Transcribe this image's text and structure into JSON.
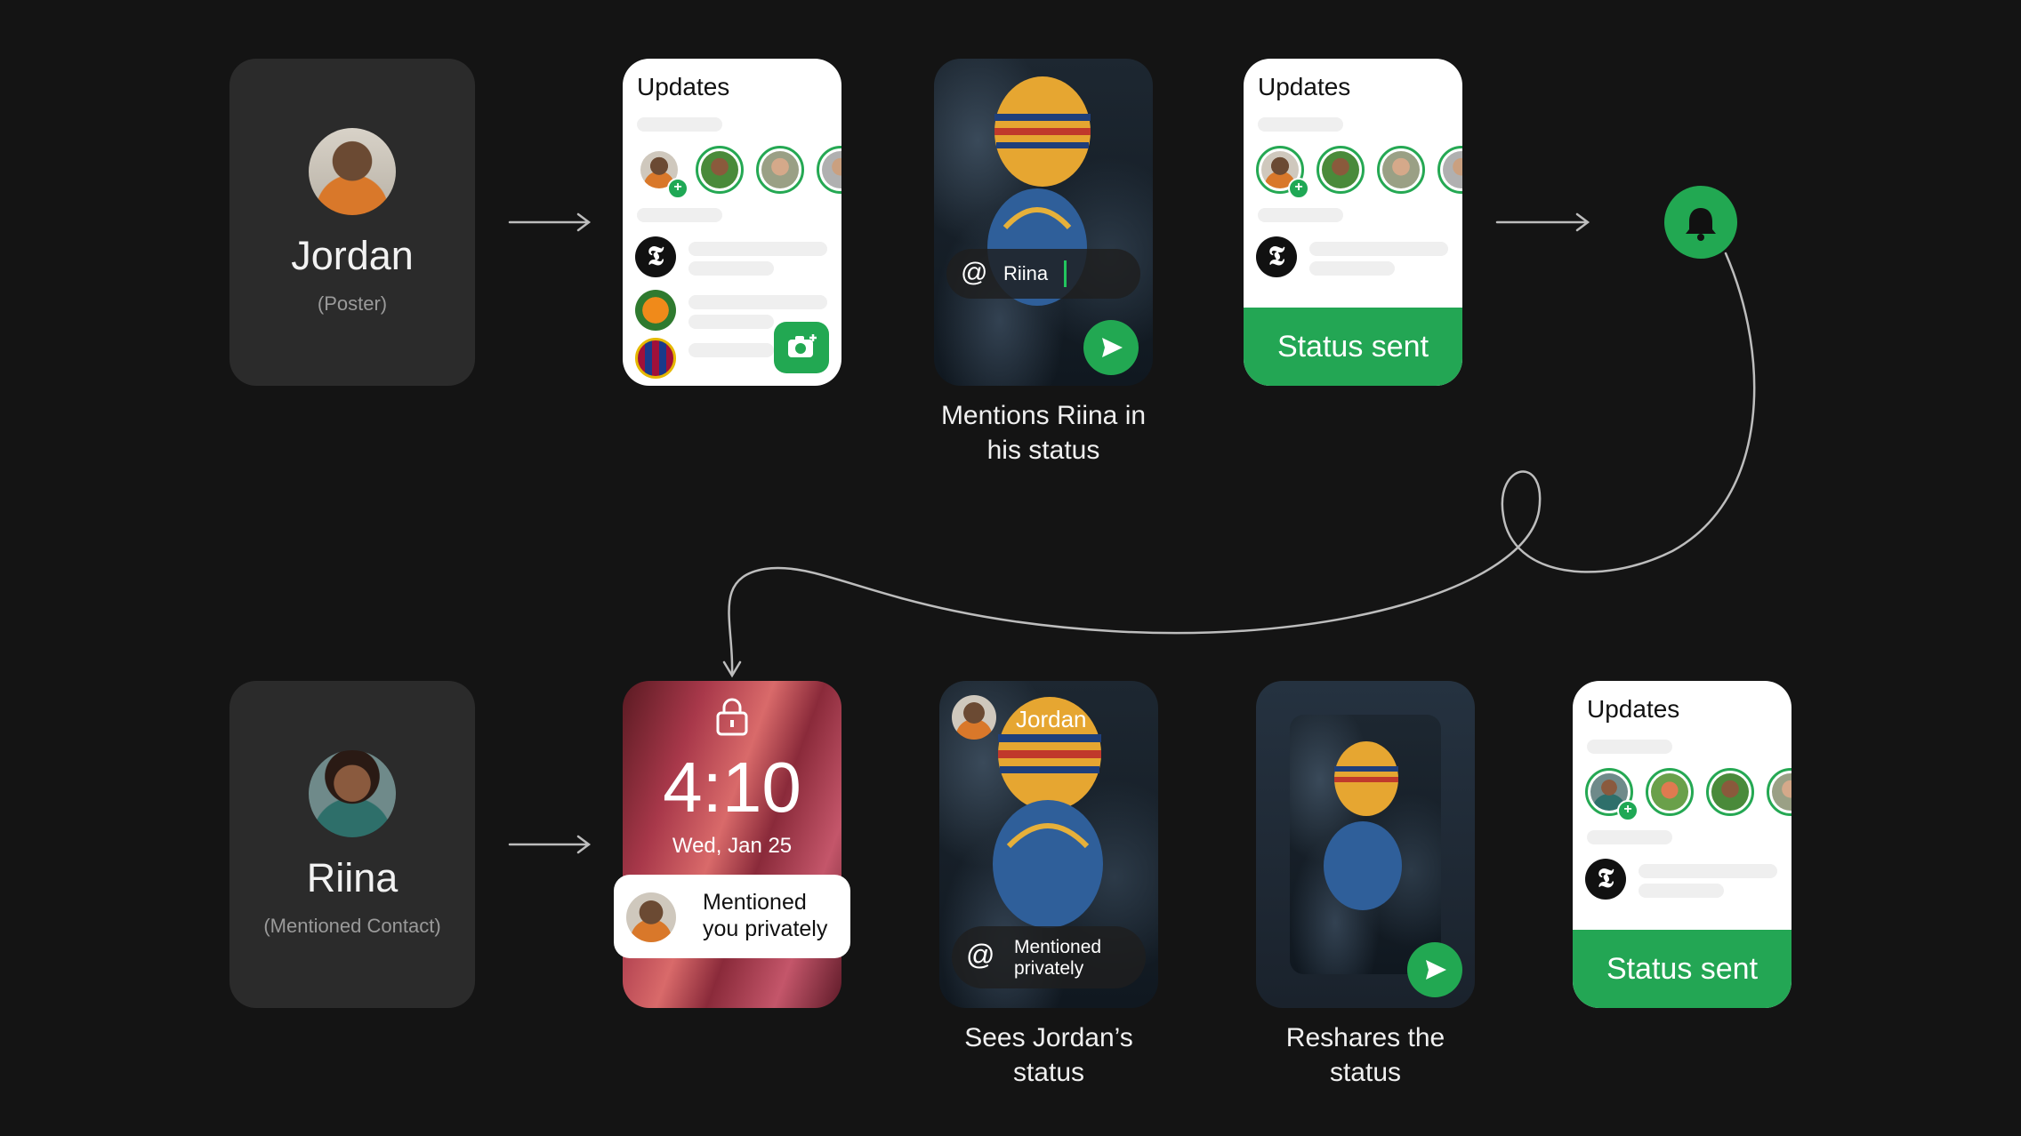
{
  "poster": {
    "name": "Jordan",
    "role": "(Poster)"
  },
  "mentioned": {
    "name": "Riina",
    "role": "(Mentioned Contact)"
  },
  "updates_screen": {
    "title": "Updates"
  },
  "compose": {
    "mention_text": "Riina",
    "caption": "Mentions Riina in his status"
  },
  "sent": {
    "label": "Status sent"
  },
  "lockscreen": {
    "time": "4:10",
    "date": "Wed, Jan 25",
    "notification": "Mentioned you privately"
  },
  "viewer": {
    "poster_name": "Jordan",
    "badge": "Mentioned privately",
    "caption": "Sees Jordan’s status"
  },
  "reshare": {
    "caption": "Reshares the status"
  },
  "colors": {
    "accent": "#23a654",
    "card": "#2b2b2b",
    "background": "#141414"
  }
}
